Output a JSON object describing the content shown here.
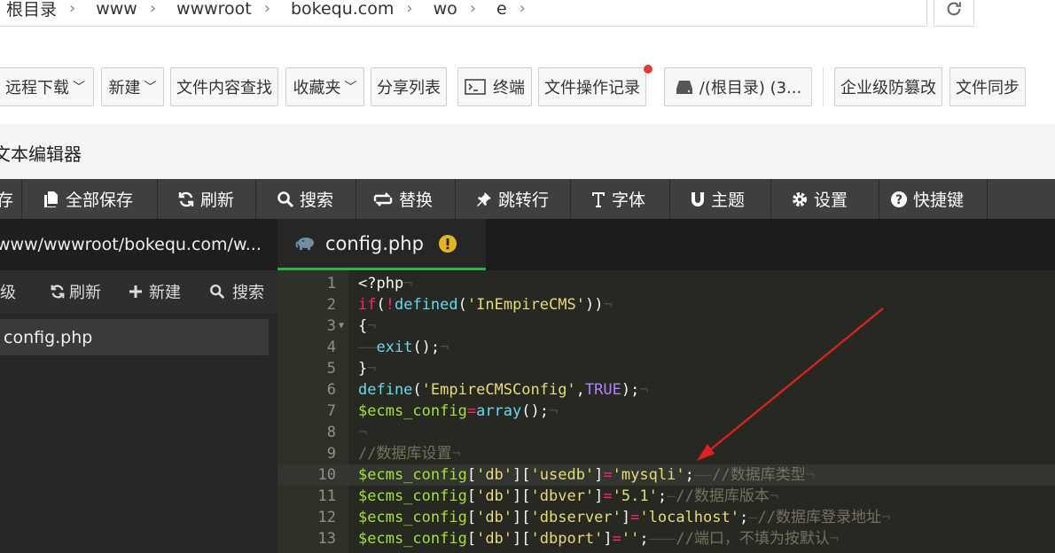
{
  "breadcrumb": [
    "根目录",
    "www",
    "wwwroot",
    "bokequ.com",
    "wo",
    "e"
  ],
  "toolbar": {
    "remote_download": "远程下载",
    "new": "新建",
    "find_in_files": "文件内容查找",
    "favorites": "收藏夹",
    "share_list": "分享列表",
    "terminal": "终端",
    "file_op_log": "文件操作记录",
    "disk": "/(根目录) (3...",
    "tamper_proof": "企业级防篡改",
    "file_sync": "文件同步"
  },
  "editor_title": "文本编辑器",
  "menu": {
    "first": "存",
    "save_all": "全部保存",
    "refresh": "刷新",
    "search": "搜索",
    "replace": "替换",
    "goto_line": "跳转行",
    "font": "字体",
    "theme": "主题",
    "settings": "设置",
    "shortcuts": "快捷键"
  },
  "tree": {
    "path": "www/wwwroot/bokequ.com/w...",
    "up": "级",
    "refresh": "刷新",
    "new": "新建",
    "search": "搜索",
    "file": "config.php"
  },
  "tab": {
    "name": "config.php"
  },
  "code": {
    "active_line": 10,
    "lines": [
      {
        "n": "1",
        "text": "<?php¬"
      },
      {
        "n": "2",
        "text": "if(!defined('InEmpireCMS'))¬"
      },
      {
        "n": "3",
        "text": "{¬"
      },
      {
        "n": "4",
        "text": "——exit();¬"
      },
      {
        "n": "5",
        "text": "}¬"
      },
      {
        "n": "6",
        "text": "define('EmpireCMSConfig',TRUE);¬"
      },
      {
        "n": "7",
        "text": "$ecms_config=array();¬"
      },
      {
        "n": "8",
        "text": "¬"
      },
      {
        "n": "9",
        "text": "//数据库设置¬"
      },
      {
        "n": "10",
        "text": "$ecms_config['db']['usedb']='mysqli';——//数据库类型¬"
      },
      {
        "n": "11",
        "text": "$ecms_config['db']['dbver']='5.1';—//数据库版本¬"
      },
      {
        "n": "12",
        "text": "$ecms_config['db']['dbserver']='localhost';—//数据库登录地址¬"
      },
      {
        "n": "13",
        "text": "$ecms_config['db']['dbport']='';———//端口，不填为按默认¬"
      }
    ]
  },
  "colors": {
    "accent_tab": "#2ab24b",
    "arrow": "#e02020",
    "dot": "#e23b3b"
  }
}
